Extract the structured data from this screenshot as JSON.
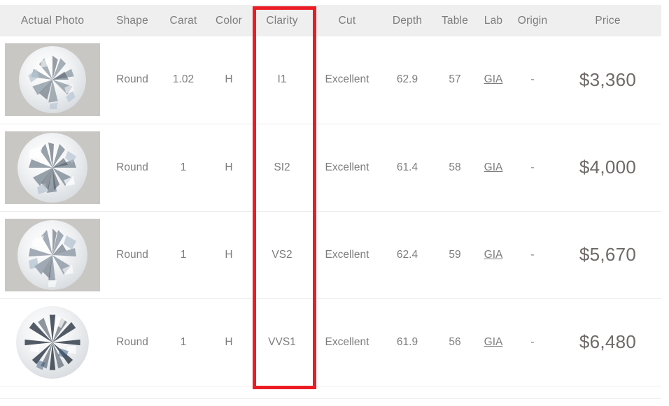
{
  "table": {
    "columns": [
      {
        "key": "photo",
        "label": "Actual Photo"
      },
      {
        "key": "shape",
        "label": "Shape"
      },
      {
        "key": "carat",
        "label": "Carat"
      },
      {
        "key": "color",
        "label": "Color"
      },
      {
        "key": "clarity",
        "label": "Clarity"
      },
      {
        "key": "cut",
        "label": "Cut"
      },
      {
        "key": "depth",
        "label": "Depth"
      },
      {
        "key": "table",
        "label": "Table"
      },
      {
        "key": "lab",
        "label": "Lab"
      },
      {
        "key": "origin",
        "label": "Origin"
      },
      {
        "key": "price",
        "label": "Price"
      }
    ],
    "rows": [
      {
        "photo_alt": "round-brilliant-diamond-photo",
        "shape": "Round",
        "carat": "1.02",
        "color": "H",
        "clarity": "I1",
        "cut": "Excellent",
        "depth": "62.9",
        "table": "57",
        "lab": "GIA",
        "origin": "-",
        "price": "$3,360"
      },
      {
        "photo_alt": "round-brilliant-diamond-photo",
        "shape": "Round",
        "carat": "1",
        "color": "H",
        "clarity": "SI2",
        "cut": "Excellent",
        "depth": "61.4",
        "table": "58",
        "lab": "GIA",
        "origin": "-",
        "price": "$4,000"
      },
      {
        "photo_alt": "round-brilliant-diamond-photo",
        "shape": "Round",
        "carat": "1",
        "color": "H",
        "clarity": "VS2",
        "cut": "Excellent",
        "depth": "62.4",
        "table": "59",
        "lab": "GIA",
        "origin": "-",
        "price": "$5,670"
      },
      {
        "photo_alt": "round-brilliant-diamond-photo",
        "shape": "Round",
        "carat": "1",
        "color": "H",
        "clarity": "VVS1",
        "cut": "Excellent",
        "depth": "61.9",
        "table": "56",
        "lab": "GIA",
        "origin": "-",
        "price": "$6,480"
      }
    ]
  },
  "annotation": {
    "highlight_column": "Clarity",
    "highlight_color": "#ec1c24"
  },
  "style": {
    "header_background": "#efefef",
    "text_color": "#7d7d7d",
    "price_color": "#6d6a68",
    "row_divider_color": "#ececec"
  }
}
